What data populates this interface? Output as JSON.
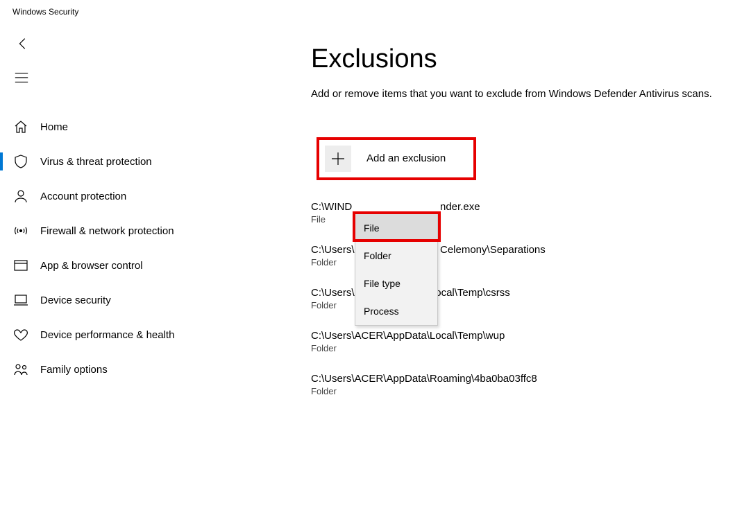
{
  "window_title": "Windows Security",
  "sidebar": {
    "items": [
      {
        "label": "Home",
        "icon": "home",
        "active": false
      },
      {
        "label": "Virus & threat protection",
        "icon": "shield",
        "active": true
      },
      {
        "label": "Account protection",
        "icon": "person",
        "active": false
      },
      {
        "label": "Firewall & network protection",
        "icon": "broadcast",
        "active": false
      },
      {
        "label": "App & browser control",
        "icon": "window",
        "active": false
      },
      {
        "label": "Device security",
        "icon": "laptop",
        "active": false
      },
      {
        "label": "Device performance & health",
        "icon": "heart",
        "active": false
      },
      {
        "label": "Family options",
        "icon": "family",
        "active": false
      }
    ]
  },
  "page": {
    "title": "Exclusions",
    "description": "Add or remove items that you want to exclude from Windows Defender Antivirus scans.",
    "add_button": "Add an exclusion"
  },
  "dropdown": {
    "items": [
      {
        "label": "File",
        "hover": true
      },
      {
        "label": "Folder",
        "hover": false
      },
      {
        "label": "File type",
        "hover": false
      },
      {
        "label": "Process",
        "hover": false
      }
    ]
  },
  "exclusions": [
    {
      "path_prefix": "C:\\WIND",
      "path_suffix": "nder.exe",
      "type": "File"
    },
    {
      "path_prefix": "C:\\Users\\",
      "path_suffix": "Celemony\\Separations",
      "type": "Folder"
    },
    {
      "path": "C:\\Users\\ACER\\AppData\\Local\\Temp\\csrss",
      "type": "Folder"
    },
    {
      "path": "C:\\Users\\ACER\\AppData\\Local\\Temp\\wup",
      "type": "Folder"
    },
    {
      "path": "C:\\Users\\ACER\\AppData\\Roaming\\4ba0ba03ffc8",
      "type": "Folder"
    }
  ]
}
